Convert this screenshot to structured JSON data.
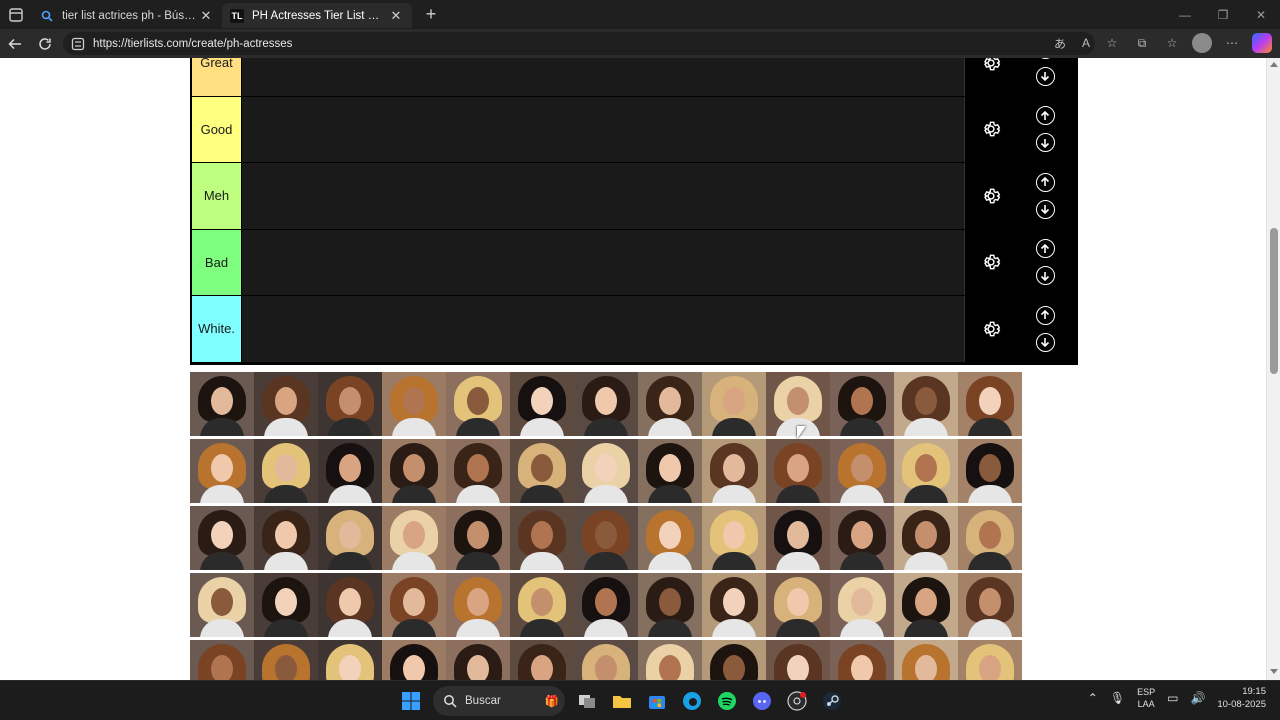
{
  "browser": {
    "tabs": [
      {
        "title": "tier list actrices ph - Búsqueda",
        "favicon": "search-icon",
        "active": false
      },
      {
        "title": "PH Actresses Tier List Maker - Ti",
        "favicon": "TL",
        "active": true
      }
    ],
    "url": "https://tierlists.com/create/ph-actresses"
  },
  "tiers": [
    {
      "label": "Great",
      "color": "#ffdf80"
    },
    {
      "label": "Good",
      "color": "#ffff7f"
    },
    {
      "label": "Meh",
      "color": "#bfff7f"
    },
    {
      "label": "Bad",
      "color": "#7fff7f"
    },
    {
      "label": "White.",
      "color": "#7fffff"
    }
  ],
  "pool": {
    "rows": 5,
    "columns": 13,
    "items_visible": 65
  },
  "taskbar": {
    "search_placeholder": "Buscar",
    "lang_line1": "ESP",
    "lang_line2": "LAA",
    "time": "19:15",
    "date": "10-08-2025"
  }
}
